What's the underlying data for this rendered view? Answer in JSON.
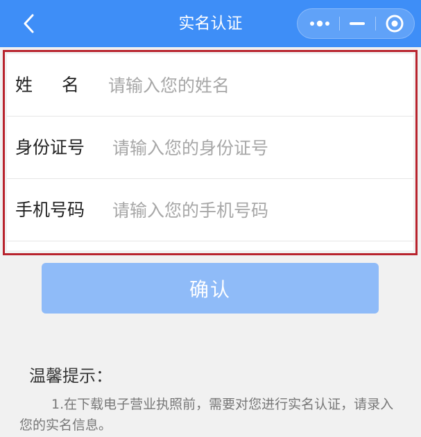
{
  "navbar": {
    "title": "实名认证",
    "back_icon": "chevron-left-icon",
    "more_icon": "more-dots-icon",
    "minimize_icon": "minus-icon",
    "close_icon": "target-circle-icon",
    "color": "#3e8ef7"
  },
  "form": {
    "fields": [
      {
        "label": "姓名",
        "placeholder": "请输入您的姓名",
        "value": ""
      },
      {
        "label": "身份证号",
        "placeholder": "请输入您的身份证号",
        "value": ""
      },
      {
        "label": "手机号码",
        "placeholder": "请输入您的手机号码",
        "value": ""
      }
    ],
    "highlight_color": "#b8232d"
  },
  "confirm": {
    "label": "确认",
    "color": "#8fbbf8"
  },
  "tips": {
    "title": "温馨提示：",
    "body": "1.在下载电子营业执照前，需要对您进行实名认证，请录入您的实名信息。"
  }
}
